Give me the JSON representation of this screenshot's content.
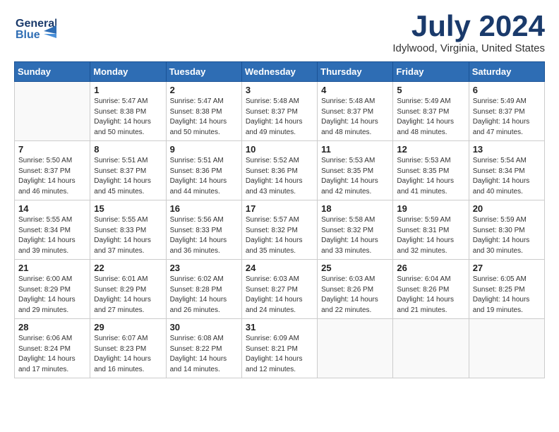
{
  "header": {
    "logo_general": "General",
    "logo_blue": "Blue",
    "month_title": "July 2024",
    "location": "Idylwood, Virginia, United States"
  },
  "weekdays": [
    "Sunday",
    "Monday",
    "Tuesday",
    "Wednesday",
    "Thursday",
    "Friday",
    "Saturday"
  ],
  "weeks": [
    [
      {
        "day": "",
        "sunrise": "",
        "sunset": "",
        "daylight": ""
      },
      {
        "day": "1",
        "sunrise": "Sunrise: 5:47 AM",
        "sunset": "Sunset: 8:38 PM",
        "daylight": "Daylight: 14 hours and 50 minutes."
      },
      {
        "day": "2",
        "sunrise": "Sunrise: 5:47 AM",
        "sunset": "Sunset: 8:38 PM",
        "daylight": "Daylight: 14 hours and 50 minutes."
      },
      {
        "day": "3",
        "sunrise": "Sunrise: 5:48 AM",
        "sunset": "Sunset: 8:37 PM",
        "daylight": "Daylight: 14 hours and 49 minutes."
      },
      {
        "day": "4",
        "sunrise": "Sunrise: 5:48 AM",
        "sunset": "Sunset: 8:37 PM",
        "daylight": "Daylight: 14 hours and 48 minutes."
      },
      {
        "day": "5",
        "sunrise": "Sunrise: 5:49 AM",
        "sunset": "Sunset: 8:37 PM",
        "daylight": "Daylight: 14 hours and 48 minutes."
      },
      {
        "day": "6",
        "sunrise": "Sunrise: 5:49 AM",
        "sunset": "Sunset: 8:37 PM",
        "daylight": "Daylight: 14 hours and 47 minutes."
      }
    ],
    [
      {
        "day": "7",
        "sunrise": "Sunrise: 5:50 AM",
        "sunset": "Sunset: 8:37 PM",
        "daylight": "Daylight: 14 hours and 46 minutes."
      },
      {
        "day": "8",
        "sunrise": "Sunrise: 5:51 AM",
        "sunset": "Sunset: 8:37 PM",
        "daylight": "Daylight: 14 hours and 45 minutes."
      },
      {
        "day": "9",
        "sunrise": "Sunrise: 5:51 AM",
        "sunset": "Sunset: 8:36 PM",
        "daylight": "Daylight: 14 hours and 44 minutes."
      },
      {
        "day": "10",
        "sunrise": "Sunrise: 5:52 AM",
        "sunset": "Sunset: 8:36 PM",
        "daylight": "Daylight: 14 hours and 43 minutes."
      },
      {
        "day": "11",
        "sunrise": "Sunrise: 5:53 AM",
        "sunset": "Sunset: 8:35 PM",
        "daylight": "Daylight: 14 hours and 42 minutes."
      },
      {
        "day": "12",
        "sunrise": "Sunrise: 5:53 AM",
        "sunset": "Sunset: 8:35 PM",
        "daylight": "Daylight: 14 hours and 41 minutes."
      },
      {
        "day": "13",
        "sunrise": "Sunrise: 5:54 AM",
        "sunset": "Sunset: 8:34 PM",
        "daylight": "Daylight: 14 hours and 40 minutes."
      }
    ],
    [
      {
        "day": "14",
        "sunrise": "Sunrise: 5:55 AM",
        "sunset": "Sunset: 8:34 PM",
        "daylight": "Daylight: 14 hours and 39 minutes."
      },
      {
        "day": "15",
        "sunrise": "Sunrise: 5:55 AM",
        "sunset": "Sunset: 8:33 PM",
        "daylight": "Daylight: 14 hours and 37 minutes."
      },
      {
        "day": "16",
        "sunrise": "Sunrise: 5:56 AM",
        "sunset": "Sunset: 8:33 PM",
        "daylight": "Daylight: 14 hours and 36 minutes."
      },
      {
        "day": "17",
        "sunrise": "Sunrise: 5:57 AM",
        "sunset": "Sunset: 8:32 PM",
        "daylight": "Daylight: 14 hours and 35 minutes."
      },
      {
        "day": "18",
        "sunrise": "Sunrise: 5:58 AM",
        "sunset": "Sunset: 8:32 PM",
        "daylight": "Daylight: 14 hours and 33 minutes."
      },
      {
        "day": "19",
        "sunrise": "Sunrise: 5:59 AM",
        "sunset": "Sunset: 8:31 PM",
        "daylight": "Daylight: 14 hours and 32 minutes."
      },
      {
        "day": "20",
        "sunrise": "Sunrise: 5:59 AM",
        "sunset": "Sunset: 8:30 PM",
        "daylight": "Daylight: 14 hours and 30 minutes."
      }
    ],
    [
      {
        "day": "21",
        "sunrise": "Sunrise: 6:00 AM",
        "sunset": "Sunset: 8:29 PM",
        "daylight": "Daylight: 14 hours and 29 minutes."
      },
      {
        "day": "22",
        "sunrise": "Sunrise: 6:01 AM",
        "sunset": "Sunset: 8:29 PM",
        "daylight": "Daylight: 14 hours and 27 minutes."
      },
      {
        "day": "23",
        "sunrise": "Sunrise: 6:02 AM",
        "sunset": "Sunset: 8:28 PM",
        "daylight": "Daylight: 14 hours and 26 minutes."
      },
      {
        "day": "24",
        "sunrise": "Sunrise: 6:03 AM",
        "sunset": "Sunset: 8:27 PM",
        "daylight": "Daylight: 14 hours and 24 minutes."
      },
      {
        "day": "25",
        "sunrise": "Sunrise: 6:03 AM",
        "sunset": "Sunset: 8:26 PM",
        "daylight": "Daylight: 14 hours and 22 minutes."
      },
      {
        "day": "26",
        "sunrise": "Sunrise: 6:04 AM",
        "sunset": "Sunset: 8:26 PM",
        "daylight": "Daylight: 14 hours and 21 minutes."
      },
      {
        "day": "27",
        "sunrise": "Sunrise: 6:05 AM",
        "sunset": "Sunset: 8:25 PM",
        "daylight": "Daylight: 14 hours and 19 minutes."
      }
    ],
    [
      {
        "day": "28",
        "sunrise": "Sunrise: 6:06 AM",
        "sunset": "Sunset: 8:24 PM",
        "daylight": "Daylight: 14 hours and 17 minutes."
      },
      {
        "day": "29",
        "sunrise": "Sunrise: 6:07 AM",
        "sunset": "Sunset: 8:23 PM",
        "daylight": "Daylight: 14 hours and 16 minutes."
      },
      {
        "day": "30",
        "sunrise": "Sunrise: 6:08 AM",
        "sunset": "Sunset: 8:22 PM",
        "daylight": "Daylight: 14 hours and 14 minutes."
      },
      {
        "day": "31",
        "sunrise": "Sunrise: 6:09 AM",
        "sunset": "Sunset: 8:21 PM",
        "daylight": "Daylight: 14 hours and 12 minutes."
      },
      {
        "day": "",
        "sunrise": "",
        "sunset": "",
        "daylight": ""
      },
      {
        "day": "",
        "sunrise": "",
        "sunset": "",
        "daylight": ""
      },
      {
        "day": "",
        "sunrise": "",
        "sunset": "",
        "daylight": ""
      }
    ]
  ]
}
